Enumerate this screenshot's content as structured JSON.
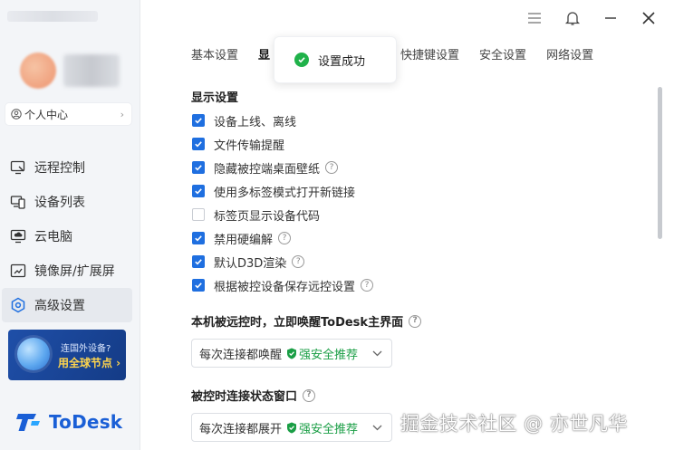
{
  "sidebar": {
    "profile_label": "个人中心",
    "nav": [
      {
        "label": "远程控制",
        "icon": "remote-control-icon"
      },
      {
        "label": "设备列表",
        "icon": "device-list-icon"
      },
      {
        "label": "云电脑",
        "icon": "cloud-pc-icon"
      },
      {
        "label": "镜像屏/扩展屏",
        "icon": "mirror-screen-icon"
      },
      {
        "label": "高级设置",
        "icon": "advanced-settings-icon",
        "active": true
      }
    ],
    "promo": {
      "line1": "连国外设备?",
      "line2": "用全球节点 ›"
    },
    "brand": "ToDesk"
  },
  "tabs": [
    "基本设置",
    "显",
    "快捷键设置",
    "安全设置",
    "网络设置"
  ],
  "toast": {
    "text": "设置成功",
    "icon": "success-check-icon"
  },
  "display_settings": {
    "title": "显示设置",
    "options": [
      {
        "label": "设备上线、离线",
        "checked": true,
        "help": false
      },
      {
        "label": "文件传输提醒",
        "checked": true,
        "help": false
      },
      {
        "label": "隐藏被控端桌面壁纸",
        "checked": true,
        "help": true
      },
      {
        "label": "使用多标签模式打开新链接",
        "checked": true,
        "help": false
      },
      {
        "label": "标签页显示设备代码",
        "checked": false,
        "help": false
      },
      {
        "label": "禁用硬编解",
        "checked": true,
        "help": true
      },
      {
        "label": "默认D3D渲染",
        "checked": true,
        "help": true
      },
      {
        "label": "根据被控设备保存远控设置",
        "checked": true,
        "help": true
      }
    ]
  },
  "wake_section": {
    "title": "本机被远控时，立即唤醒ToDesk主界面",
    "select_value": "每次连接都唤醒",
    "badge": "强安全推荐"
  },
  "status_section": {
    "title": "被控时连接状态窗口",
    "select_value": "每次连接都展开",
    "badge": "强安全推荐"
  },
  "watermark": "掘金技术社区 @ 亦世凡华",
  "colors": {
    "accent": "#1f6fe0",
    "recommend": "#1a9e45",
    "success": "#20b24a"
  }
}
